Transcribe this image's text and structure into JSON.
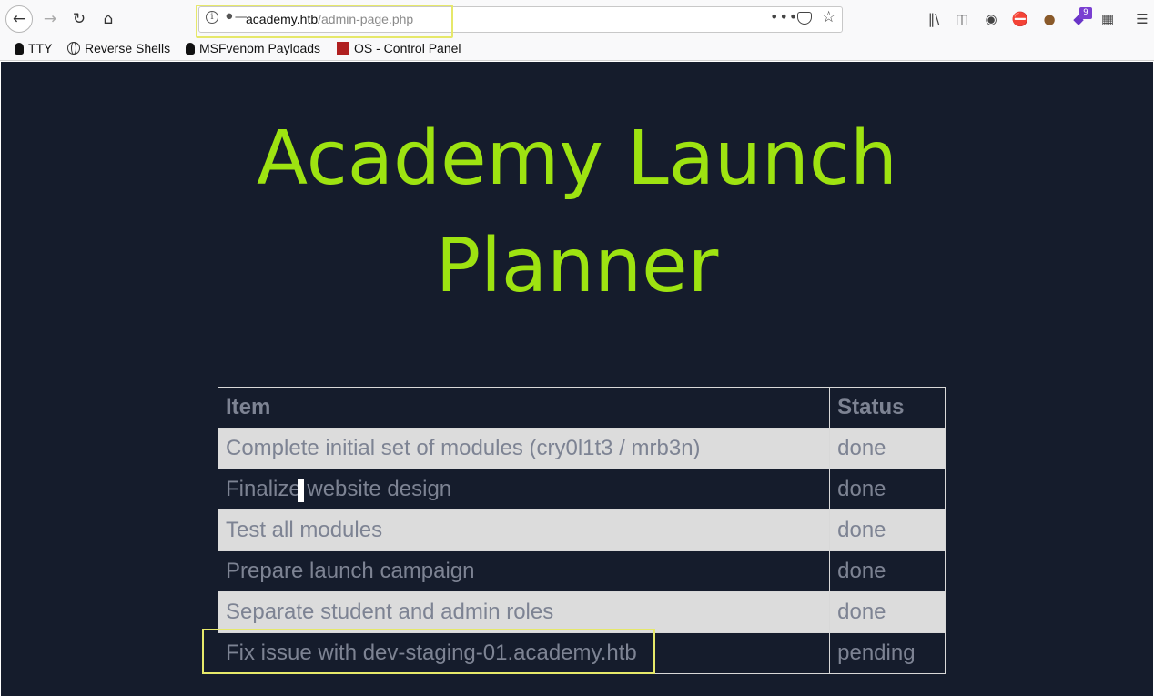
{
  "browser": {
    "url_host": "academy.htb",
    "url_path": "/admin-page.php",
    "extension_badge": "9",
    "bookmarks": [
      {
        "label": "TTY",
        "icon": "tux-icon"
      },
      {
        "label": "Reverse Shells",
        "icon": "globe-icon"
      },
      {
        "label": "MSFvenom Payloads",
        "icon": "tux-icon"
      },
      {
        "label": "OS - Control Panel",
        "icon": "os-icon"
      }
    ]
  },
  "page": {
    "title_line1": "Academy Launch",
    "title_line2": "Planner",
    "title_color": "#9ee311",
    "background_color": "#151c2c"
  },
  "table": {
    "headers": {
      "item": "Item",
      "status": "Status"
    },
    "rows": [
      {
        "item": "Complete initial set of modules (cry0l1t3 / mrb3n)",
        "status": "done"
      },
      {
        "item_before_cursor": "Finalize",
        "item_after_cursor": "website design",
        "status": "done"
      },
      {
        "item": "Test all modules",
        "status": "done"
      },
      {
        "item": "Prepare launch campaign",
        "status": "done"
      },
      {
        "item": "Separate student and admin roles",
        "status": "done"
      },
      {
        "item": "Fix issue with dev-staging-01.academy.htb",
        "status": "pending"
      }
    ]
  },
  "highlight_color": "#e6e86a"
}
